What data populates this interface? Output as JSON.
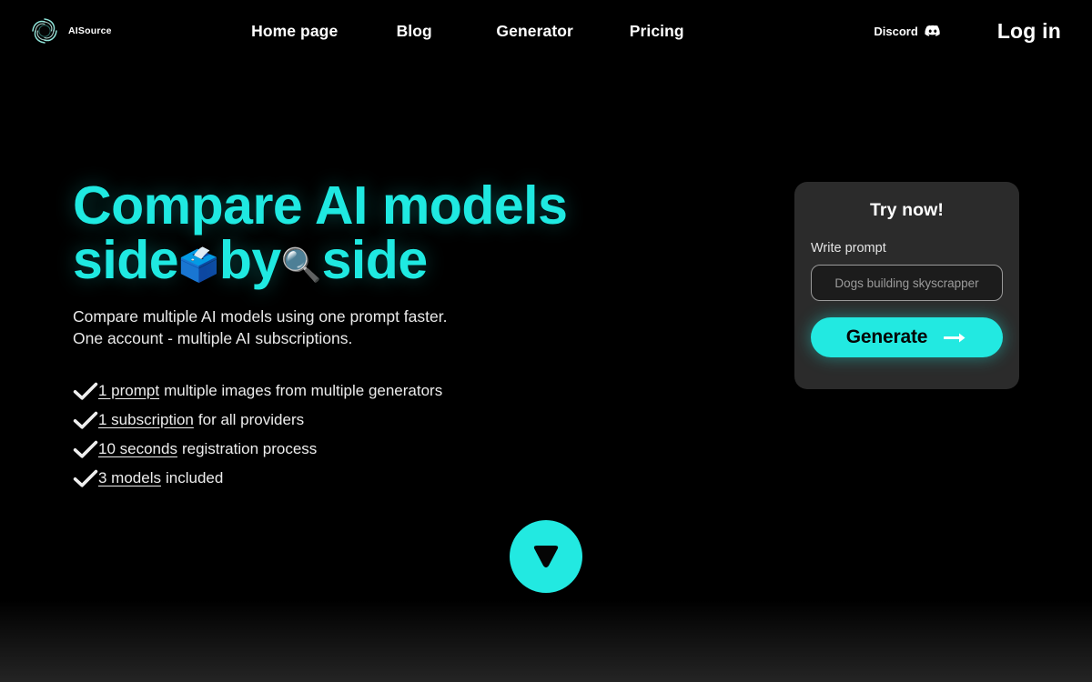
{
  "brand": {
    "name": "AISource",
    "logo_icon": "spiral-logo-icon"
  },
  "nav": {
    "links": [
      {
        "label": "Home page"
      },
      {
        "label": "Blog"
      },
      {
        "label": "Generator"
      },
      {
        "label": "Pricing"
      }
    ],
    "discord": {
      "label": "Discord",
      "icon": "discord-icon"
    },
    "login": {
      "label": "Log in"
    }
  },
  "hero": {
    "headline_line1": "Compare AI models",
    "headline_line2_a": "side",
    "headline_emoji1": "🗳️",
    "headline_line2_b": "by",
    "headline_emoji2": "🔍",
    "headline_line2_c": "side",
    "subtitle_line1": "Compare multiple AI models using one prompt faster.",
    "subtitle_line2": "One account - multiple AI subscriptions.",
    "features": [
      {
        "strong": "1 prompt",
        "rest": "multiple images from multiple generators",
        "icon": "check-icon"
      },
      {
        "strong": "1 subscription",
        "rest": "for all providers",
        "icon": "check-icon"
      },
      {
        "strong": "10 seconds",
        "rest": "registration process",
        "icon": "check-icon"
      },
      {
        "strong": "3 models",
        "rest": "included",
        "icon": "check-icon"
      }
    ]
  },
  "try_card": {
    "title": "Try now!",
    "prompt_label": "Write prompt",
    "prompt_placeholder": "Dogs building skyscrapper",
    "prompt_value": "",
    "generate_label": "Generate",
    "generate_icon": "arrow-right-icon"
  },
  "scroll": {
    "icon": "scroll-down-triangle-icon"
  },
  "colors": {
    "accent": "#22E9E1",
    "background": "#000000",
    "card_background": "#2B2B2B",
    "input_background": "#1C1C1C",
    "text_primary": "#FFFFFF",
    "text_muted": "#9B9B9B"
  }
}
